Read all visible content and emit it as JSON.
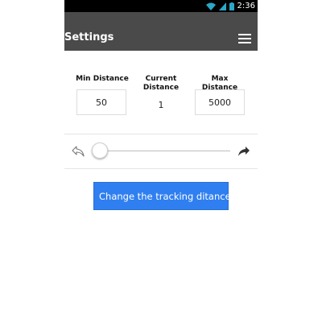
{
  "status_bar": {
    "time": "2:36",
    "icons": [
      "wifi-icon",
      "cellular-signal-icon",
      "battery-icon"
    ]
  },
  "app_bar": {
    "title": "Settings",
    "menu_icon": "hamburger-menu-icon"
  },
  "distance": {
    "min_label": "Min Distance",
    "min_value": "50",
    "current_label_line1": "Current",
    "current_label_line2": "Distance",
    "current_value": "1",
    "max_label": "Max Distance",
    "max_value": "5000"
  },
  "slider": {
    "undo_icon": "undo-arrow-icon",
    "redo_icon": "redo-arrow-icon",
    "position_fraction": 0.0
  },
  "action": {
    "button_label": "Change the tracking ditance",
    "button_color": "#2f7ff0"
  },
  "colors": {
    "app_bar": "#4a4a4a",
    "status_bar": "#000000",
    "accent": "#2f7ff0"
  }
}
